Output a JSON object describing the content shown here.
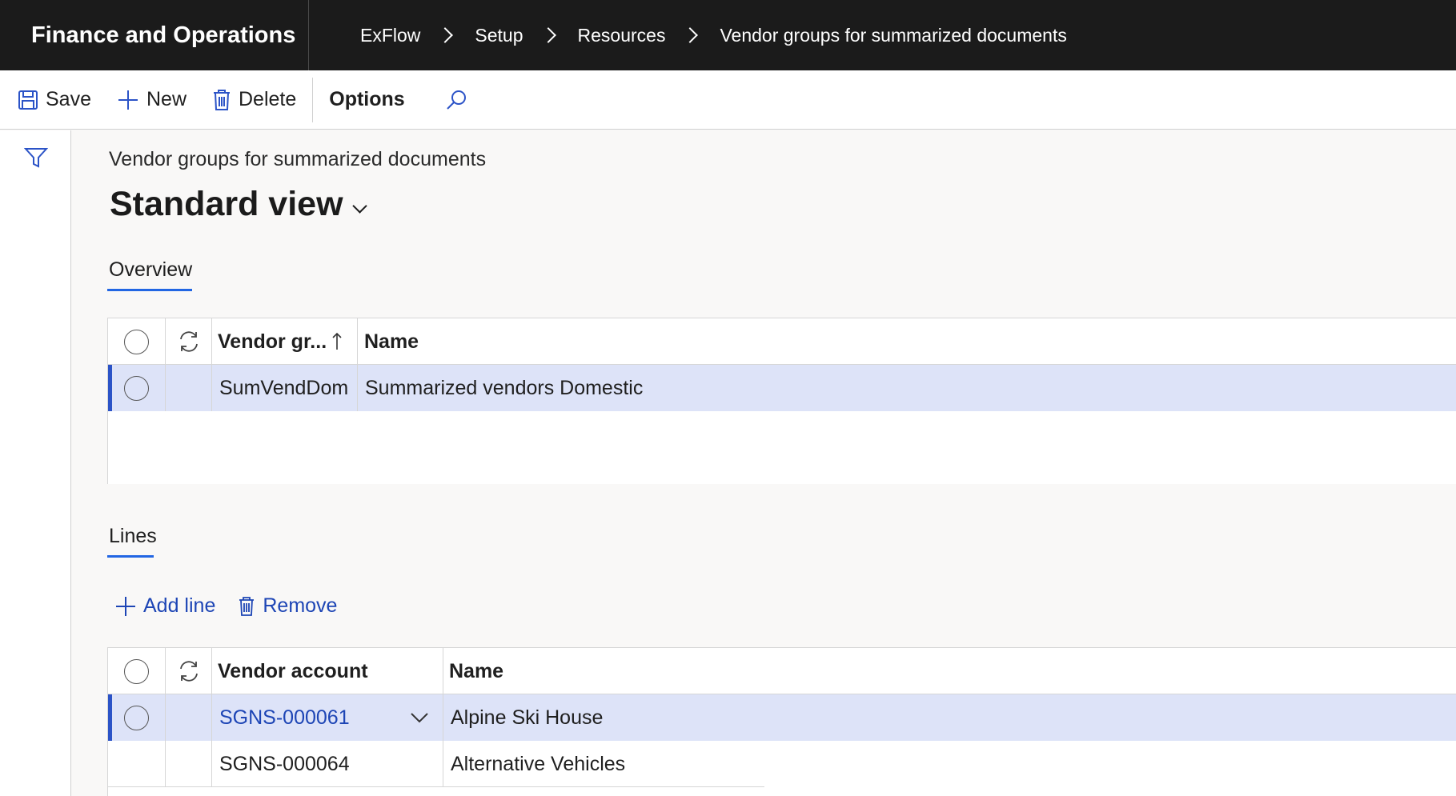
{
  "app": {
    "title": "Finance and Operations"
  },
  "breadcrumb": [
    "ExFlow",
    "Setup",
    "Resources",
    "Vendor groups for summarized documents"
  ],
  "actions": {
    "save": "Save",
    "new": "New",
    "delete": "Delete",
    "options": "Options"
  },
  "page": {
    "caption": "Vendor groups for summarized documents",
    "view": "Standard view"
  },
  "overview": {
    "tab": "Overview",
    "columns": [
      "Vendor gr...",
      "Name"
    ],
    "rows": [
      {
        "vendor_group": "SumVendDom",
        "name": "Summarized vendors Domestic",
        "selected": true
      }
    ]
  },
  "lines": {
    "tab": "Lines",
    "toolbar": {
      "add": "Add line",
      "remove": "Remove"
    },
    "columns": [
      "Vendor account",
      "Name"
    ],
    "rows": [
      {
        "account": "SGNS-000061",
        "name": "Alpine Ski House",
        "selected": true
      },
      {
        "account": "SGNS-000064",
        "name": "Alternative Vehicles",
        "selected": false
      }
    ]
  },
  "colors": {
    "accent": "#2266e3",
    "selection": "#dde3f8",
    "link": "#1d45b5",
    "topbar": "#1b1b1b"
  }
}
